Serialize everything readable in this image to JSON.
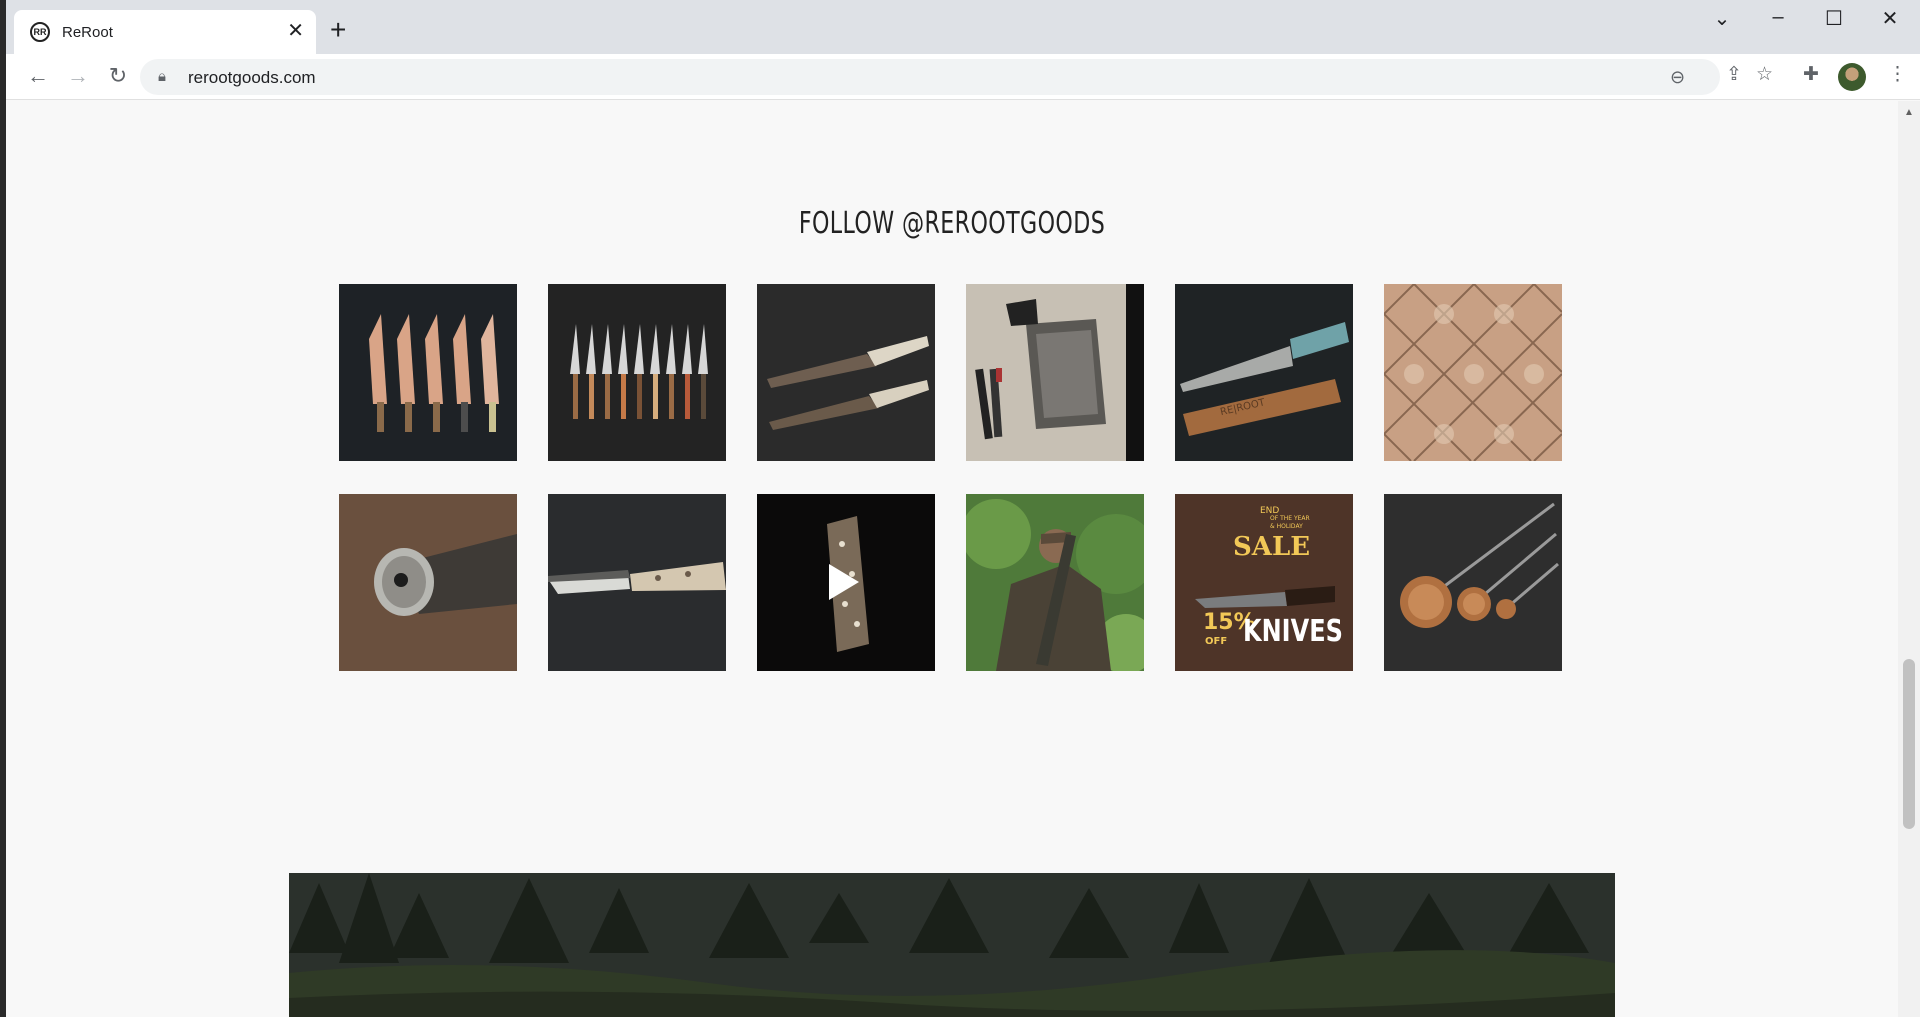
{
  "browser": {
    "tab_title": "ReRoot",
    "favicon_text": "RR",
    "url": "rerootgoods.com",
    "icons": {
      "tab_close": "close-icon",
      "new_tab": "plus-icon",
      "back": "arrow-left-icon",
      "forward": "arrow-right-icon",
      "reload": "reload-icon",
      "lock": "lock-icon",
      "zoom": "zoom-out-icon",
      "share": "share-icon",
      "bookmark": "star-icon",
      "extensions": "puzzle-icon",
      "menu": "kebab-menu-icon"
    }
  },
  "page": {
    "heading": "FOLLOW @REROOTGOODS",
    "instagram_posts": [
      {
        "subject": "five copper knives with sheaths"
      },
      {
        "subject": "row of nine knives with wood handles"
      },
      {
        "subject": "two knives in leather sheaths"
      },
      {
        "subject": "fossil drawing with pencils"
      },
      {
        "subject": "kitchen knife with wooden saya"
      },
      {
        "subject": "end grain wood diamond pattern"
      },
      {
        "subject": "knife handle pommel close-up"
      },
      {
        "subject": "knife with antler handle"
      },
      {
        "subject": "leather roll video",
        "is_video": true
      },
      {
        "subject": "man carrying knife in forest"
      },
      {
        "subject": "end of year holiday sale",
        "text_lines": [
          "END",
          "OF THE YEAR",
          "& HOLIDAY",
          "SALE",
          "15%",
          "OFF",
          "KNIVES"
        ]
      },
      {
        "subject": "three copper ladles"
      }
    ]
  },
  "colors": {
    "page_bg": "#f8f8f8",
    "heading": "#222222",
    "tab_strip": "#dee1e6"
  }
}
